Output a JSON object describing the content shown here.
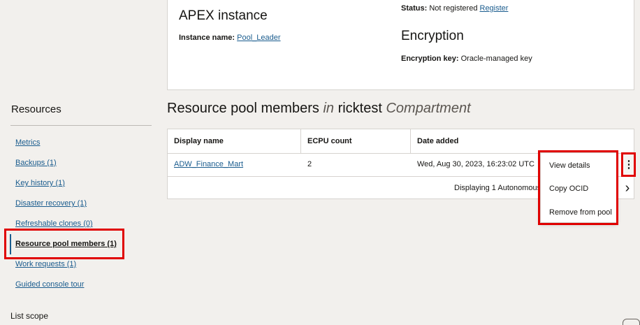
{
  "instance_card": {
    "apex_title": "APEX instance",
    "instance_name_label": "Instance name:",
    "instance_name_value": "Pool_Leader",
    "status_label": "Status:",
    "status_value": "Not registered",
    "register_link": "Register",
    "encryption_title": "Encryption",
    "encryption_key_label": "Encryption key:",
    "encryption_key_value": "Oracle-managed key"
  },
  "sidebar": {
    "title": "Resources",
    "items": [
      {
        "label": "Metrics"
      },
      {
        "label": "Backups (1)"
      },
      {
        "label": "Key history (1)"
      },
      {
        "label": "Disaster recovery (1)"
      },
      {
        "label": "Refreshable clones (0)"
      },
      {
        "label": "Resource pool members (1)"
      },
      {
        "label": "Work requests (1)"
      },
      {
        "label": "Guided console tour"
      }
    ],
    "active_index": 5,
    "list_scope": "List scope"
  },
  "section": {
    "title_prefix": "Resource pool members",
    "title_in": "in",
    "title_compartment_name": "ricktest",
    "title_compartment_word": "Compartment"
  },
  "table": {
    "columns": [
      "Display name",
      "ECPU count",
      "Date added"
    ],
    "rows": [
      {
        "display_name": "ADW_Finance_Mart",
        "ecpu_count": "2",
        "date_added": "Wed, Aug 30, 2023, 16:23:02 UTC"
      }
    ],
    "footer": "Displaying 1 Autonomous"
  },
  "row_menu": {
    "items": [
      "View details",
      "Copy OCID",
      "Remove from pool"
    ]
  },
  "icons": {
    "kebab": "vertical-ellipsis-icon",
    "next": "chevron-right-icon"
  },
  "colors": {
    "highlight": "#e00000",
    "link": "#1a5c8e"
  }
}
